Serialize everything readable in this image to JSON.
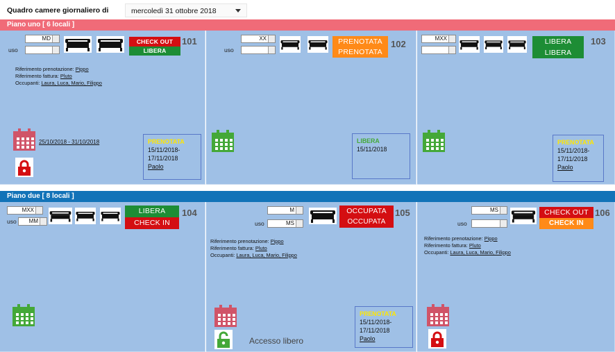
{
  "header": {
    "title": "Quadro camere giornaliero di",
    "date": "mercoledì 31 ottobre 2018"
  },
  "floors": [
    {
      "label": "Piano uno [ 6 locali ]"
    },
    {
      "label": "Piano due [ 8 locali ]"
    }
  ],
  "labels": {
    "uso": "uso",
    "rif_pren": "Riferimento prenotazione:",
    "rif_fatt": "Riferimento fattura:",
    "occupanti": "Occupanti:"
  },
  "rooms": [
    {
      "number": "101",
      "type": "MD",
      "uso": "",
      "status_top": "CHECK OUT",
      "status_bottom": "LIBERA",
      "pren": "Pippo",
      "fatt": "Pluto",
      "occupants": "Laura, Luca, Mario, Filippo",
      "range": "25/10/2018 - 31/10/2018",
      "next_status": "PRENOTATA",
      "next_dates": "15/11/2018-17/11/2018",
      "next_name": "Paolo"
    },
    {
      "number": "102",
      "type": "XX",
      "uso": "",
      "status_top": "PRENOTATA",
      "status_bottom": "PRENOTATA",
      "next_status": "LIBERA",
      "next_dates": "15/11/2018"
    },
    {
      "number": "103",
      "type": "MXX",
      "uso": "",
      "status_top": "LIBERA",
      "status_bottom": "LIBERA",
      "next_status": "PRENOTATA",
      "next_dates": "15/11/2018-17/11/2018",
      "next_name": "Paolo"
    },
    {
      "number": "104",
      "type": "MXX",
      "uso": "MM",
      "status_top": "LIBERA",
      "status_bottom": "CHECK IN"
    },
    {
      "number": "105",
      "type": "M",
      "uso": "MS",
      "status_top": "OCCUPATA",
      "status_bottom": "OCCUPATA",
      "pren": "Pippo",
      "fatt": "Pluto",
      "occupants": "Laura, Luca, Mario, Filippo",
      "accesso": "Accesso libero",
      "next_status": "PRENOTATA",
      "next_dates": "15/11/2018-17/11/2018",
      "next_name": "Paolo"
    },
    {
      "number": "106",
      "type": "MS",
      "uso": "",
      "status_top": "CHECK OUT",
      "status_bottom": "CHECK IN",
      "pren": "Pippo",
      "fatt": "Pluto",
      "occupants": "Laura, Luca, Mario, Filippo"
    }
  ],
  "colors": {
    "floor1": "#f06b78",
    "floor2": "#1273b8",
    "room_bg": "#9fc0e6",
    "red": "#d40e12",
    "green": "#1d8d35",
    "orange": "#ff8a18",
    "yellow": "#ffe600",
    "next_libera": "#44a838"
  },
  "icons": [
    "bed-icon",
    "calendar-icon",
    "lock-icon",
    "unlock-icon",
    "chevron-down-icon"
  ]
}
